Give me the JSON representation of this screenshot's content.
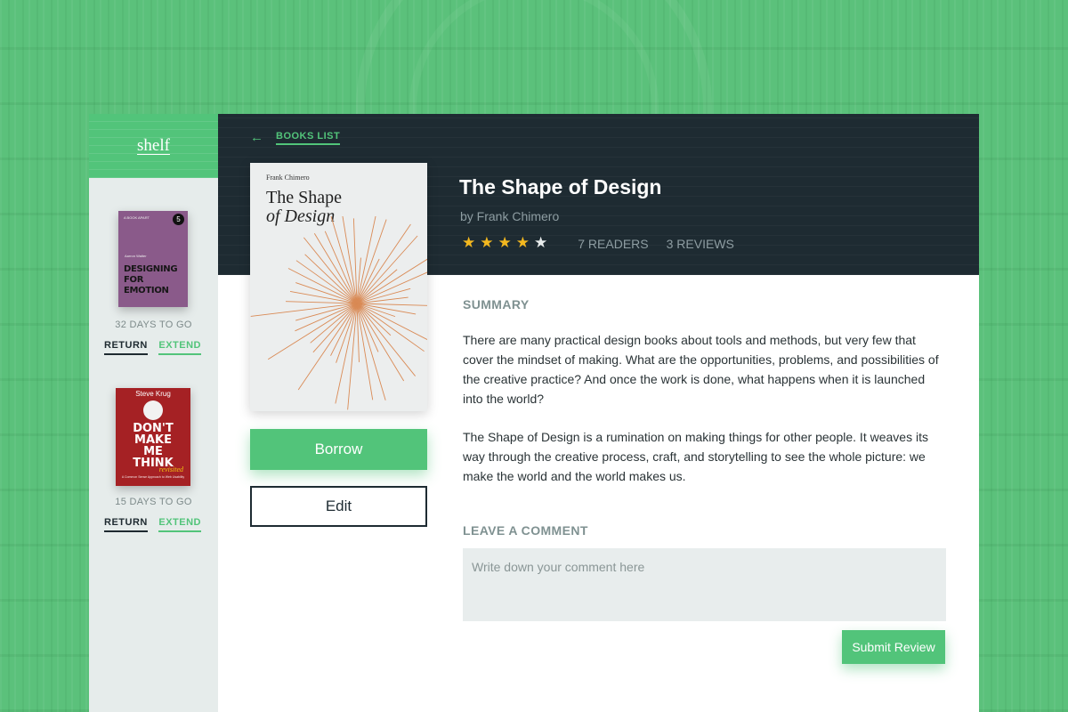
{
  "app": {
    "brand": "shelf"
  },
  "sidebar": {
    "loans": [
      {
        "cover": {
          "badge": "5",
          "top_text": "A BOOK APART",
          "author": "Aarron Walter",
          "title_line1": "DESIGNING",
          "title_line2": "FOR EMOTION",
          "color": "#8a5a8a"
        },
        "days_left": "32 DAYS TO GO",
        "return_label": "RETURN",
        "extend_label": "EXTEND"
      },
      {
        "cover": {
          "author": "Steve Krug",
          "line1": "DON'T",
          "line2": "MAKE",
          "line3": "ME",
          "line4": "THINK",
          "tag": "revisited",
          "subtitle": "A Common Sense Approach to Web Usability",
          "color": "#a52124"
        },
        "days_left": "15 DAYS TO GO",
        "return_label": "RETURN",
        "extend_label": "EXTEND"
      }
    ]
  },
  "header": {
    "back_label": "BOOKS LIST",
    "back_icon": "arrow-left-icon",
    "title": "The Shape of Design",
    "author_line": "by Frank Chimero",
    "rating": 4,
    "rating_max": 5,
    "readers": "7 READERS",
    "reviews": "3 REVIEWS"
  },
  "book": {
    "cover_author": "Frank Chimero",
    "cover_title_line1": "The Shape",
    "cover_title_line2": "of Design"
  },
  "actions": {
    "borrow_label": "Borrow",
    "edit_label": "Edit"
  },
  "summary": {
    "heading": "SUMMARY",
    "paragraphs": [
      "There are many practical design books about tools and methods, but very few that cover the mindset of making. What are the opportunities, problems, and possibilities of the creative practice? And once the work is done, what happens when it is launched into the world?",
      "The Shape of Design is a rumination on making things for other people. It weaves its way through the creative process, craft, and storytelling to see the whole picture: we make the world and the world makes us."
    ]
  },
  "comment": {
    "heading": "LEAVE A COMMENT",
    "placeholder": "Write down your comment here",
    "value": "",
    "submit_label": "Submit Review"
  },
  "colors": {
    "accent": "#52c47a",
    "dark": "#1e2b32",
    "star": "#f3b81f"
  }
}
